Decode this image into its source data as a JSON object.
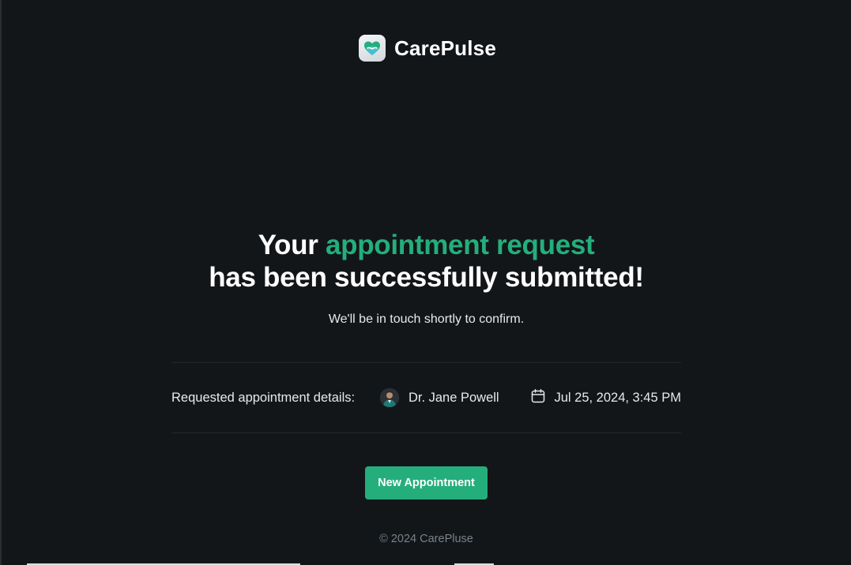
{
  "brand": {
    "name": "CarePulse",
    "icon": "heart-hands-logo-icon"
  },
  "headline": {
    "prefix": "Your ",
    "accent": "appointment request",
    "suffix": " has been successfully submitted!"
  },
  "subtext": "We'll be in touch shortly to confirm.",
  "details": {
    "label": "Requested appointment details:",
    "doctor_name": "Dr. Jane Powell",
    "datetime": "Jul 25, 2024, 3:45 PM",
    "calendar_icon": "calendar-icon"
  },
  "button": {
    "label": "New Appointment"
  },
  "footer": {
    "copyright": "© 2024 CarePluse"
  },
  "colors": {
    "background": "#131619",
    "accent": "#24ae7c",
    "muted": "#76828d"
  }
}
